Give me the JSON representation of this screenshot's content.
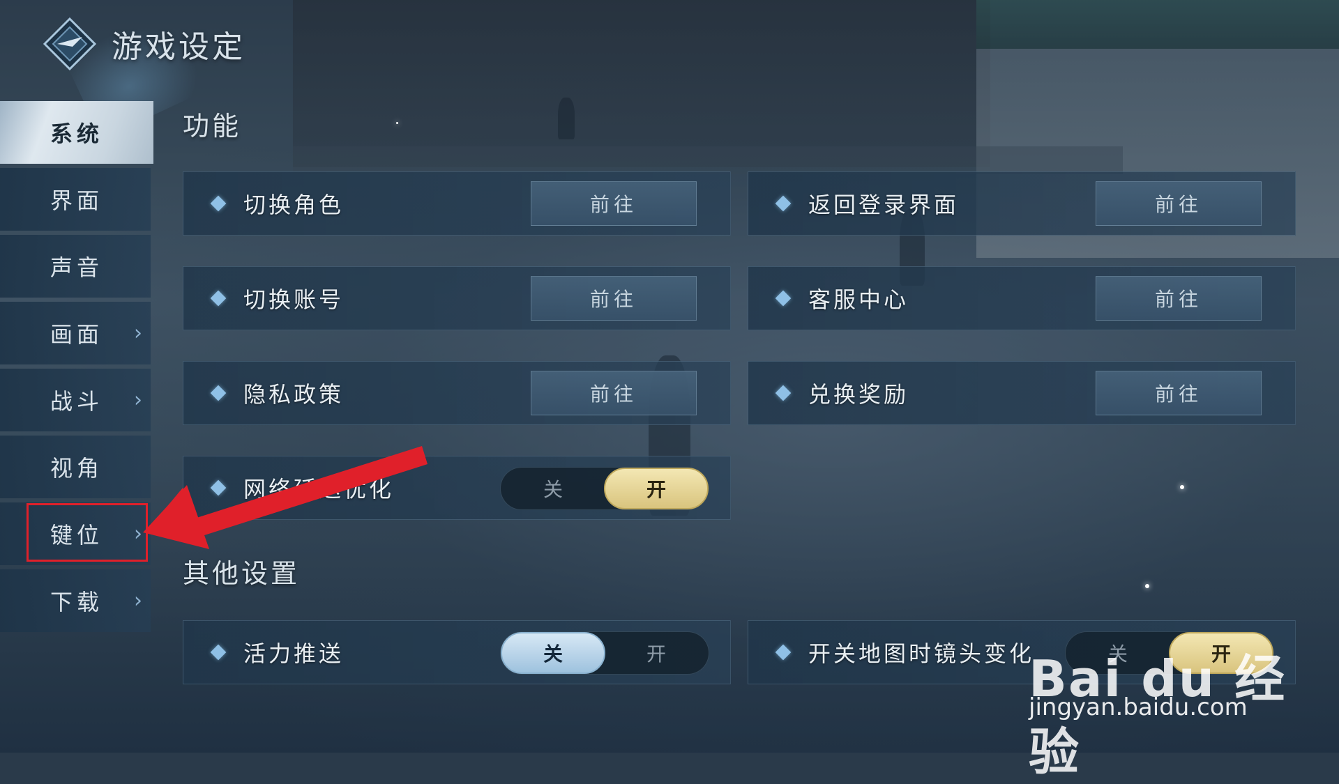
{
  "header": {
    "title": "游戏设定",
    "logo_icon": "diamond-emblem-icon"
  },
  "sidebar": {
    "items": [
      {
        "label": "系统",
        "active": true,
        "has_arrow": false
      },
      {
        "label": "界面",
        "active": false,
        "has_arrow": false
      },
      {
        "label": "声音",
        "active": false,
        "has_arrow": false
      },
      {
        "label": "画面",
        "active": false,
        "has_arrow": true
      },
      {
        "label": "战斗",
        "active": false,
        "has_arrow": true
      },
      {
        "label": "视角",
        "active": false,
        "has_arrow": false
      },
      {
        "label": "键位",
        "active": false,
        "has_arrow": true,
        "highlighted": true
      },
      {
        "label": "下载",
        "active": false,
        "has_arrow": true
      }
    ],
    "arrow_glyph": "›"
  },
  "sections": {
    "function": {
      "title": "功能",
      "rows": [
        {
          "label": "切换角色",
          "button": "前往"
        },
        {
          "label": "返回登录界面",
          "button": "前往"
        },
        {
          "label": "切换账号",
          "button": "前往"
        },
        {
          "label": "客服中心",
          "button": "前往"
        },
        {
          "label": "隐私政策",
          "button": "前往"
        },
        {
          "label": "兑换奖励",
          "button": "前往"
        }
      ],
      "toggle_row": {
        "label": "网络延迟优化",
        "off": "关",
        "on": "开",
        "state": "on"
      }
    },
    "other": {
      "title": "其他设置",
      "rows": [
        {
          "label": "活力推送",
          "off": "关",
          "on": "开",
          "state": "off"
        },
        {
          "label": "开关地图时镜头变化",
          "off": "关",
          "on": "开",
          "state": "on"
        }
      ]
    }
  },
  "annotation": {
    "color": "#e0202a"
  },
  "watermark": {
    "brand": "Bai du 经验",
    "url": "jingyan.baidu.com"
  }
}
